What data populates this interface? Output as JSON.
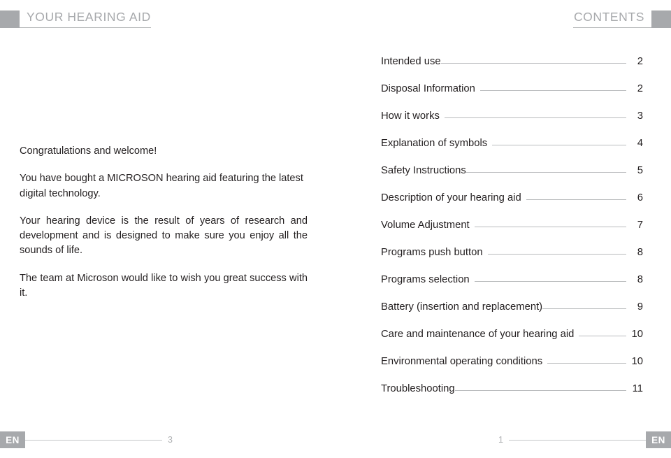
{
  "header": {
    "left_title": "YOUR HEARING AID",
    "right_title": "CONTENTS",
    "accent_color": "#a7a9ac"
  },
  "welcome": {
    "paragraphs": [
      "Congratulations and welcome!",
      "You have bought a MICROSON hearing aid featuring the latest digital technology.",
      "Your hearing device is the result of years of research and development and is designed to make sure you enjoy all the sounds of life.",
      "The team at Microson would like to wish you great success with it."
    ]
  },
  "contents": {
    "entries": [
      {
        "label": "Intended use",
        "page": "2"
      },
      {
        "label": "Disposal Information",
        "page": "2"
      },
      {
        "label": "How it works",
        "page": "3"
      },
      {
        "label": "Explanation of symbols",
        "page": "4"
      },
      {
        "label": "Safety Instructions",
        "page": "5"
      },
      {
        "label": "Description of your hearing aid",
        "page": "6"
      },
      {
        "label": "Volume Adjustment",
        "page": "7"
      },
      {
        "label": "Programs push button",
        "page": "8"
      },
      {
        "label": "Programs selection",
        "page": "8"
      },
      {
        "label": "Battery (insertion and replacement)",
        "page": "9"
      },
      {
        "label": "Care and maintenance of your hearing aid",
        "page": "10"
      },
      {
        "label": "Environmental operating conditions",
        "page": "10"
      },
      {
        "label": "Troubleshooting",
        "page": "11"
      }
    ]
  },
  "footer": {
    "left_badge": "EN",
    "left_page": "3",
    "right_page": "1",
    "right_badge": "EN"
  }
}
